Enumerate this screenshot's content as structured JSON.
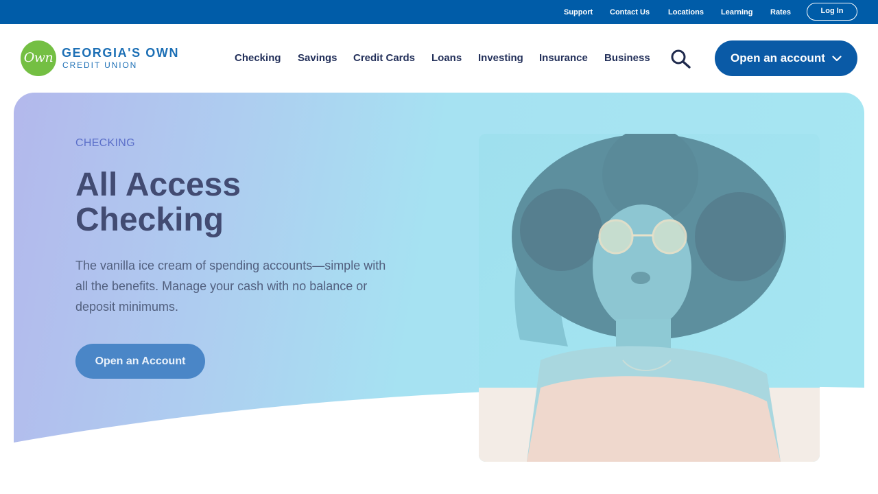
{
  "utility_nav": {
    "links": [
      "Support",
      "Contact Us",
      "Locations",
      "Learning",
      "Rates"
    ],
    "login_label": "Log In"
  },
  "brand": {
    "logo_mark": "Own",
    "name_line1": "GEORGIA'S OWN",
    "name_line2": "CREDIT UNION"
  },
  "main_nav": {
    "items": [
      "Checking",
      "Savings",
      "Credit Cards",
      "Loans",
      "Investing",
      "Insurance",
      "Business"
    ],
    "search_icon": "search-icon",
    "cta_label": "Open an account",
    "cta_icon": "chevron-down-icon"
  },
  "hero": {
    "eyebrow": "CHECKING",
    "title": "All Access Checking",
    "description": "The vanilla ice cream of spending accounts—simple with all the benefits. Manage your cash with no balance or deposit minimums.",
    "cta_label": "Open an Account",
    "image_subject": "woman with curly hair and round glasses"
  },
  "colors": {
    "utility_bar": "#005ca8",
    "brand_blue": "#1c6fb5",
    "brand_green": "#74bf43",
    "nav_text": "#23305a",
    "primary_button": "#0a5aa6",
    "hero_gradient_start": "#b3b8ec",
    "hero_gradient_end": "#a6e6f2",
    "hero_title": "#424b72",
    "eyebrow": "#5b6fc9"
  }
}
